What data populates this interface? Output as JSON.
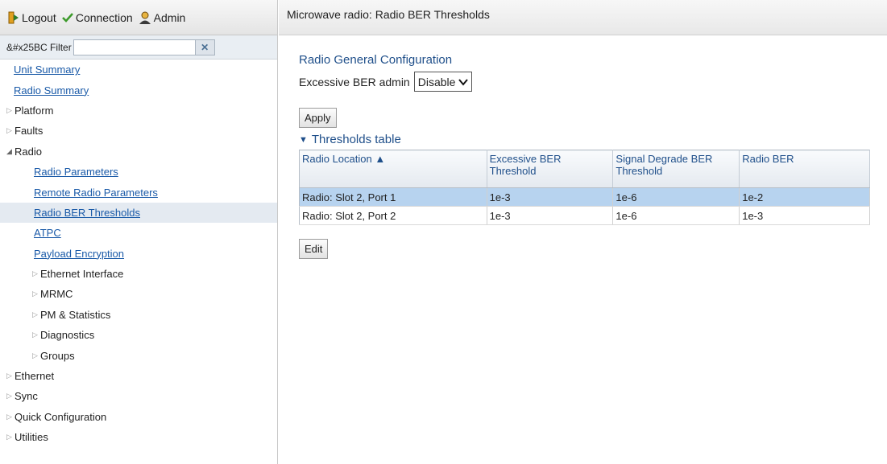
{
  "toolbar": {
    "logout_label": "Logout",
    "connection_label": "Connection",
    "admin_label": "Admin"
  },
  "filter": {
    "label": "&#x25BC Filter",
    "value": "",
    "clear_glyph": "✕"
  },
  "nav": {
    "unit_summary": "Unit Summary",
    "radio_summary": "Radio Summary",
    "platform": "Platform",
    "faults": "Faults",
    "radio": "Radio",
    "radio_parameters": "Radio Parameters",
    "remote_radio_parameters": "Remote Radio Parameters",
    "radio_ber_thresholds": "Radio BER Thresholds",
    "atpc": "ATPC",
    "payload_encryption": "Payload Encryption",
    "ethernet_interface": "Ethernet Interface",
    "mrmc": "MRMC",
    "pm_statistics": "PM & Statistics",
    "diagnostics": "Diagnostics",
    "groups": "Groups",
    "ethernet": "Ethernet",
    "sync": "Sync",
    "quick_configuration": "Quick Configuration",
    "utilities": "Utilities"
  },
  "page": {
    "header": "Microwave radio: Radio BER Thresholds",
    "section_title": "Radio General Configuration",
    "ber_admin_label": "Excessive BER admin",
    "ber_admin_value": "Disable",
    "apply_label": "Apply",
    "thresholds_toggle": "Thresholds table",
    "edit_label": "Edit"
  },
  "table": {
    "headers": [
      "Radio Location ▲",
      "Excessive BER Threshold",
      "Signal Degrade BER Threshold",
      "Radio BER"
    ],
    "rows": [
      [
        "Radio: Slot 2, Port 1",
        "1e-3",
        "1e-6",
        "1e-2"
      ],
      [
        "Radio: Slot 2, Port 2",
        "1e-3",
        "1e-6",
        "1e-3"
      ]
    ],
    "selected_row": 0
  },
  "colors": {
    "link": "#1a5aa8",
    "heading": "#1f4f8a",
    "selected_row": "#b7d3ef",
    "tree_selected": "#e4eaf1"
  }
}
